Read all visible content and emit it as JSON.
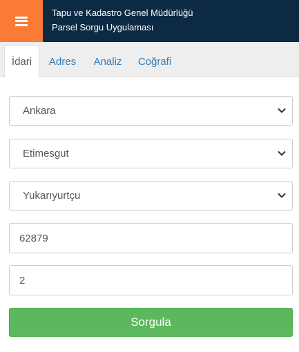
{
  "header": {
    "menu_icon": "hamburger-menu-icon",
    "title_line1": "Tapu ve Kadastro Genel Müdürlüğü",
    "title_line2": "Parsel Sorgu Uygulaması",
    "colors": {
      "header_bg": "#0d2a44",
      "menu_bg": "#fb7a35"
    }
  },
  "tabs": [
    {
      "label": "İdari",
      "active": true
    },
    {
      "label": "Adres",
      "active": false
    },
    {
      "label": "Analiz",
      "active": false
    },
    {
      "label": "Coğrafi",
      "active": false
    }
  ],
  "form": {
    "province": {
      "value": "Ankara",
      "icon": "chevron-down-icon"
    },
    "district": {
      "value": "Etimesgut",
      "icon": "chevron-down-icon"
    },
    "neighborhood": {
      "value": "Yukarıyurtçu",
      "icon": "chevron-down-icon"
    },
    "block": {
      "value": "62879"
    },
    "parcel": {
      "value": "2"
    },
    "submit_label": "Sorgula",
    "colors": {
      "submit_bg": "#5cb85c",
      "tab_link": "#337ab7"
    }
  }
}
